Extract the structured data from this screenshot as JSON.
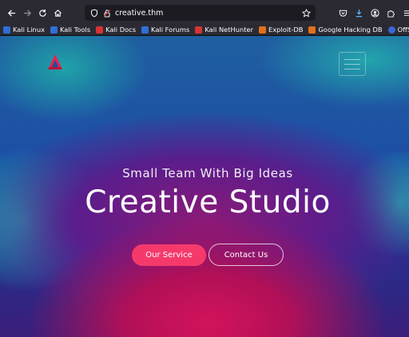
{
  "browser": {
    "url": "creative.thm",
    "nav": {
      "back_icon": "arrow-left-icon",
      "forward_icon": "arrow-right-icon",
      "reload_icon": "reload-icon",
      "home_icon": "home-icon"
    },
    "toolbar_icons": [
      "shield-icon",
      "pocket-icon",
      "download-icon",
      "account-icon",
      "extensions-icon",
      "menu-icon"
    ]
  },
  "bookmarks": [
    {
      "label": "Kali Linux",
      "color": "#2f6fd6"
    },
    {
      "label": "Kali Tools",
      "color": "#2f6fd6"
    },
    {
      "label": "Kali Docs",
      "color": "#d63333"
    },
    {
      "label": "Kali Forums",
      "color": "#2f6fd6"
    },
    {
      "label": "Kali NetHunter",
      "color": "#d63333"
    },
    {
      "label": "Exploit-DB",
      "color": "#e0701c"
    },
    {
      "label": "Google Hacking DB",
      "color": "#e0701c"
    },
    {
      "label": "OffSec",
      "color": "#3a67d8"
    }
  ],
  "hero": {
    "subtitle": "Small Team With Big Ideas",
    "title": "Creative Studio",
    "primary_button": "Our Service",
    "secondary_button": "Contact Us"
  },
  "colors": {
    "accent": "#f53a6b",
    "chrome_bg": "#2b2a33",
    "urlbar_bg": "#1c1b22"
  }
}
